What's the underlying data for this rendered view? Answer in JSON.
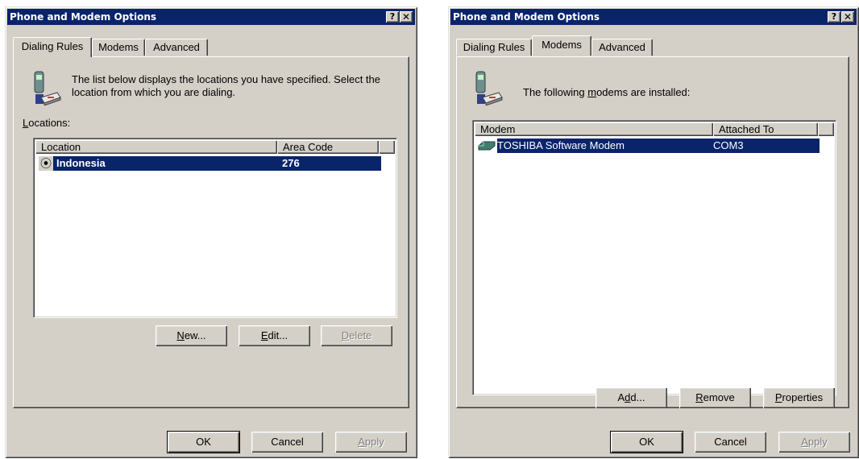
{
  "left_dialog": {
    "title": "Phone and Modem Options",
    "help_button": "?",
    "close_button": "✕",
    "tabs": [
      "Dialing Rules",
      "Modems",
      "Advanced"
    ],
    "active_tab": "Dialing Rules",
    "intro_text": "The list below displays the locations you have specified. Select the location from which you are dialing.",
    "locations_label": "Locations:",
    "columns": [
      "Location",
      "Area Code"
    ],
    "rows": [
      {
        "location": "Indonesia",
        "area_code": "276",
        "selected": true,
        "default_marker": "⦿"
      }
    ],
    "buttons": {
      "new": "New...",
      "edit": "Edit...",
      "delete": "Delete"
    },
    "footer": {
      "ok": "OK",
      "cancel": "Cancel",
      "apply": "Apply"
    }
  },
  "right_dialog": {
    "title": "Phone and Modem Options",
    "help_button": "?",
    "close_button": "✕",
    "tabs": [
      "Dialing Rules",
      "Modems",
      "Advanced"
    ],
    "active_tab": "Modems",
    "intro_text": "The following modems are installed:",
    "columns": [
      "Modem",
      "Attached To"
    ],
    "rows": [
      {
        "modem": "TOSHIBA Software Modem",
        "attached_to": "COM3",
        "selected": true
      }
    ],
    "buttons": {
      "add": "Add...",
      "remove": "Remove",
      "properties": "Properties"
    },
    "footer": {
      "ok": "OK",
      "cancel": "Cancel",
      "apply": "Apply"
    }
  },
  "colors": {
    "title_bar": "#0a246a",
    "face": "#d4d0c8",
    "selection": "#0a246a"
  },
  "icons": [
    "phone-modem-icon",
    "modem-device-icon",
    "default-location-icon",
    "help-icon",
    "close-icon"
  ]
}
